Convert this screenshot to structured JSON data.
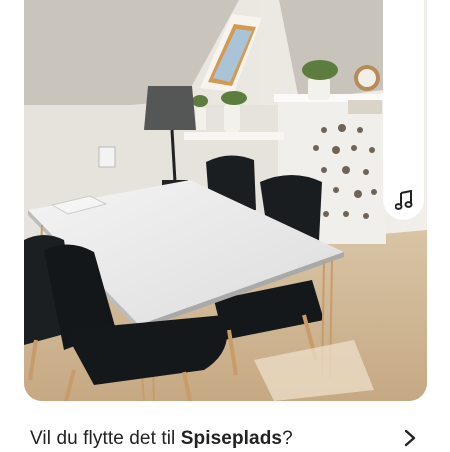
{
  "suggestion": {
    "prefix": "Vil du flytte det til ",
    "room": "Spiseplads",
    "suffix": "?"
  },
  "icons": {
    "music": "music-note-icon",
    "next": "chevron-right-icon"
  },
  "colors": {
    "text": "#222222",
    "background": "#ffffff"
  }
}
